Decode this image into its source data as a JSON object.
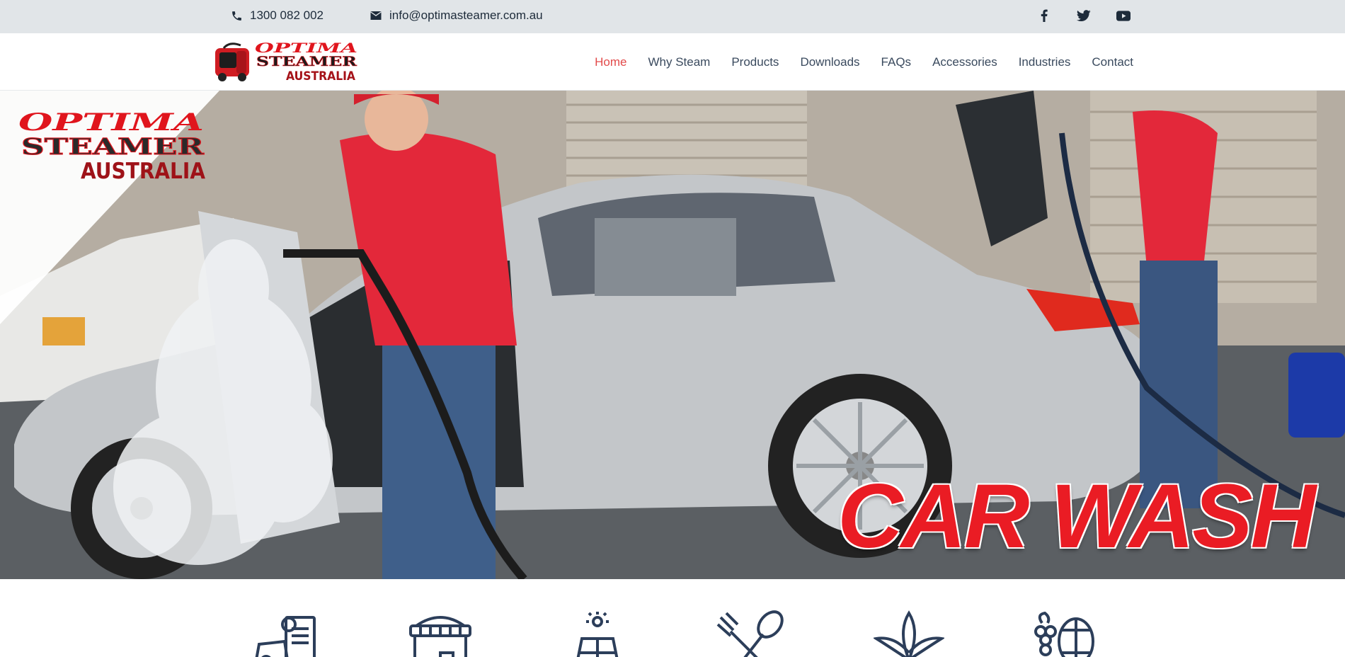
{
  "topbar": {
    "phone": "1300 082 002",
    "email": "info@optimasteamer.com.au",
    "icons": [
      "phone-icon",
      "envelope-icon",
      "facebook-icon",
      "twitter-icon",
      "youtube-icon"
    ]
  },
  "brand": {
    "logo_line1": "OPTIMA",
    "logo_line2": "STEAMER",
    "logo_line3": "AUSTRALIA"
  },
  "nav": {
    "items": [
      {
        "label": "Home",
        "active": true
      },
      {
        "label": "Why Steam",
        "active": false
      },
      {
        "label": "Products",
        "active": false
      },
      {
        "label": "Downloads",
        "active": false
      },
      {
        "label": "FAQs",
        "active": false
      },
      {
        "label": "Accessories",
        "active": false
      },
      {
        "label": "Industries",
        "active": false
      },
      {
        "label": "Contact",
        "active": false
      }
    ]
  },
  "hero": {
    "title": "CAR WASH",
    "logo_line1": "OPTIMA",
    "logo_line2": "STEAMER",
    "logo_line3": "AUSTRALIA"
  },
  "industries": {
    "icons": [
      "auto-service-icon",
      "storefront-icon",
      "solar-panel-icon",
      "cutlery-icon",
      "leaf-icon",
      "winery-icon"
    ]
  },
  "colors": {
    "accent_red": "#e24a4a",
    "brand_red": "#ea1c24",
    "topbar_bg": "#e1e5e8",
    "nav_text": "#3a4a5e",
    "icon_navy": "#2c3e5a"
  }
}
